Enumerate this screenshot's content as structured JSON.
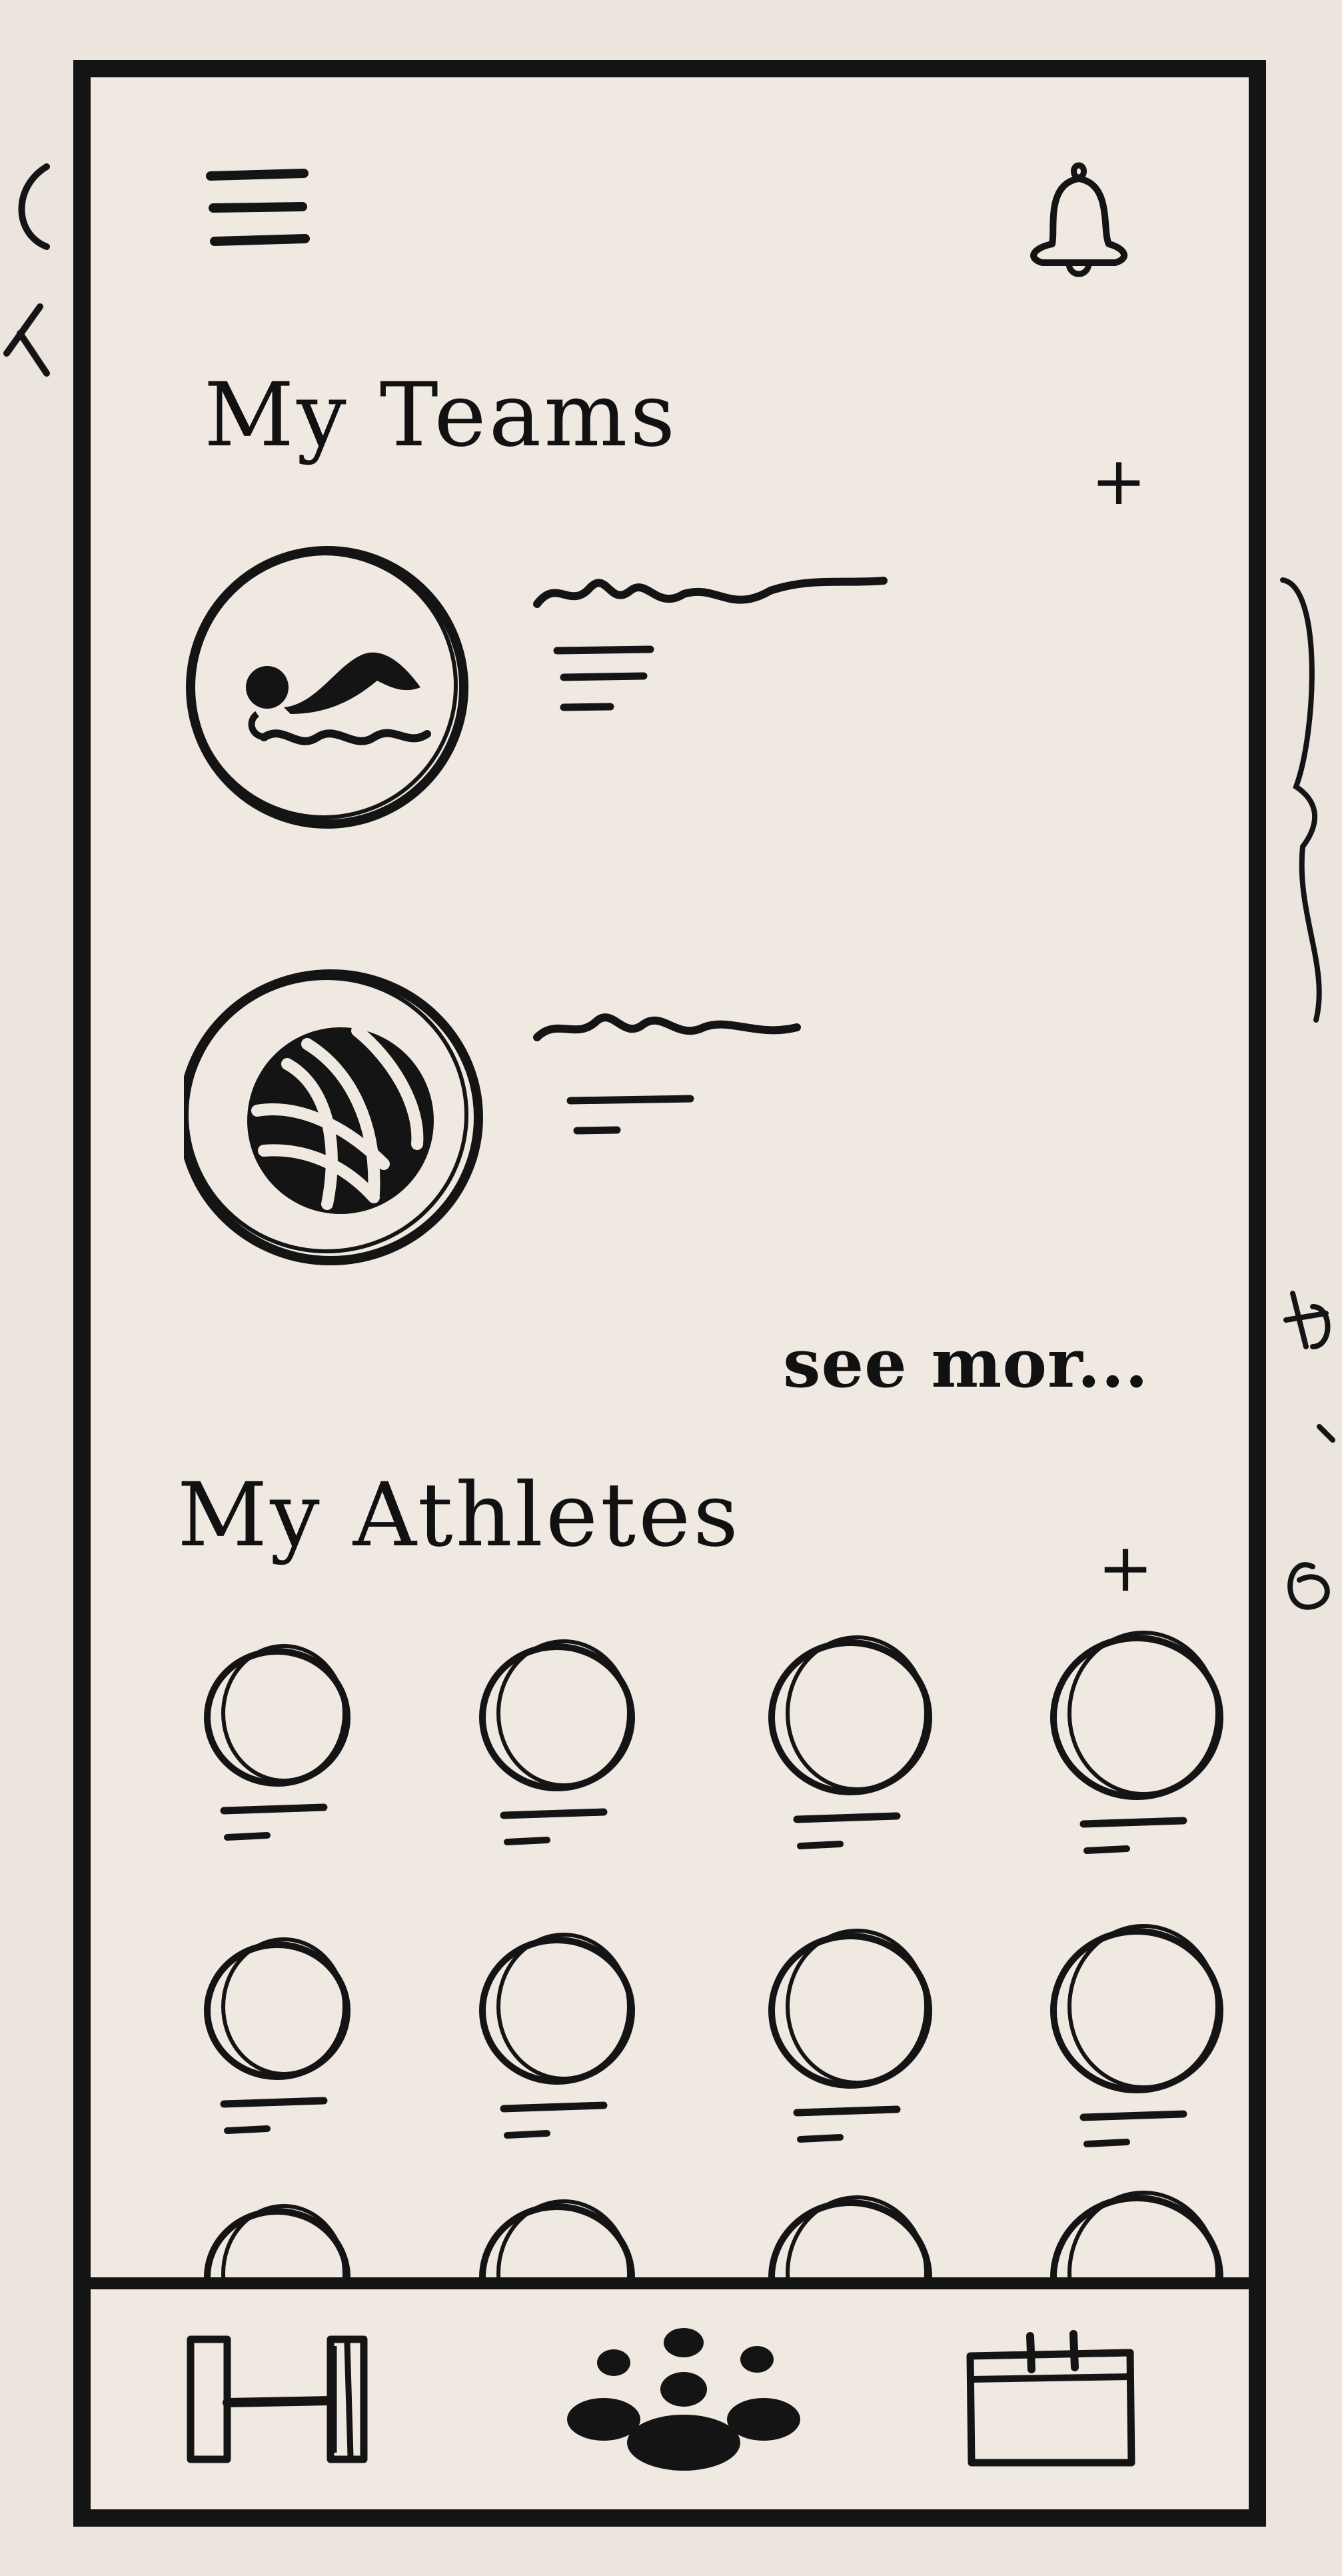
{
  "screen": {
    "header": {
      "menu_icon": "hamburger-menu-icon",
      "notification_icon": "bell-icon"
    },
    "my_teams": {
      "title": "My Teams",
      "add_label": "+",
      "teams": [
        {
          "logo_icon": "swimmer-icon"
        },
        {
          "logo_icon": "volleyball-icon"
        }
      ],
      "see_more_label": "see mor..."
    },
    "my_athletes": {
      "title": "My Athletes",
      "add_label": "+",
      "athletes": [
        {
          "avatar_icon": "athlete-avatar-icon"
        },
        {
          "avatar_icon": "athlete-avatar-icon"
        },
        {
          "avatar_icon": "athlete-avatar-icon"
        },
        {
          "avatar_icon": "athlete-avatar-icon"
        },
        {
          "avatar_icon": "athlete-avatar-icon"
        },
        {
          "avatar_icon": "athlete-avatar-icon"
        },
        {
          "avatar_icon": "athlete-avatar-icon"
        },
        {
          "avatar_icon": "athlete-avatar-icon"
        },
        {
          "avatar_icon": "athlete-avatar-icon"
        },
        {
          "avatar_icon": "athlete-avatar-icon"
        },
        {
          "avatar_icon": "athlete-avatar-icon"
        },
        {
          "avatar_icon": "athlete-avatar-icon"
        }
      ]
    },
    "tab_bar": {
      "tabs": [
        {
          "icon": "dumbbell-icon"
        },
        {
          "icon": "people-group-icon"
        },
        {
          "icon": "calendar-icon"
        }
      ]
    }
  },
  "colors": {
    "paper": "#ebe5de",
    "ink": "#141414"
  }
}
